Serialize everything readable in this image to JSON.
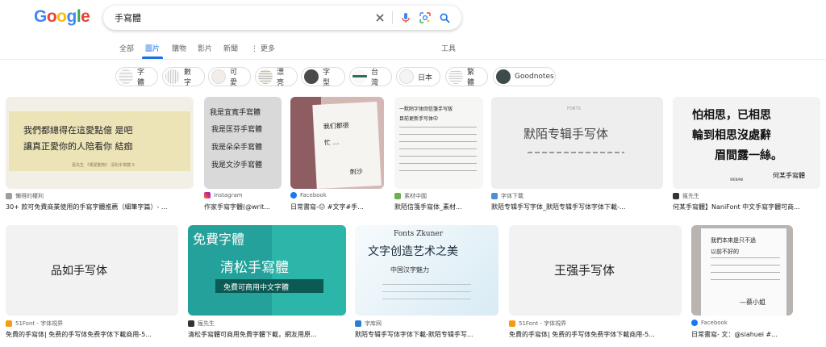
{
  "logo": {
    "text": "Google"
  },
  "search": {
    "query": "手寫體"
  },
  "nav": {
    "tabs": [
      "全部",
      "圖片",
      "購物",
      "影片",
      "新聞",
      "更多"
    ],
    "tools": "工具"
  },
  "chips": [
    "字體",
    "數字",
    "可愛",
    "漂亮",
    "字 型",
    "台灣",
    "日本",
    "繁體",
    "Goodnotes"
  ],
  "results": [
    {
      "source": "懶得的權利",
      "title": "30+ 款可免費商業使用的手寫字體推薦（細筆字篇）- ...",
      "lines": [
        "我們都總得在這愛點億 是吧",
        "讓真正愛你的人陪看你 結痂"
      ],
      "caption": "嘉先生 《嘆愛動物》 清松手寫體 5"
    },
    {
      "source": "Instagram",
      "title": "作家手寫字體(@writ...",
      "lines": [
        "我是宜寬手寫體",
        "我是匡芬手寫體",
        "我是朵朵手寫體",
        "我是文汐手寫體"
      ]
    },
    {
      "source": "Facebook",
      "title": "日常書寫-😐 #文字#手...",
      "lines": [
        "我们都很",
        "忙 …",
        "刺沙"
      ]
    },
    {
      "source": "素材中國",
      "title": "默陌信箋手寫体_素材...",
      "lines": [
        "一默陌字体回信箋手写版",
        "目前更新手写体中",
        "…"
      ]
    },
    {
      "source": "字体下載",
      "title": "默陌专辑手写字体_默陌专辑手写体字体下載-...",
      "lines": [
        "默陌专辑手写体"
      ],
      "caption": "FONTS"
    },
    {
      "source": "瘋先生",
      "title": "何某手寫體】NaniFont 中文手寫字體可商...",
      "lines": [
        "怕相思，已相思",
        "輪到相思沒處辭",
        "眉間露一絲。"
      ],
      "caption": "何某手寫體",
      "brand": "WENANI"
    },
    {
      "source": "51Font - 字体視界",
      "title": "免費的手寫体| 免费的手写体免费字体下載商用-5...",
      "lines": [
        "品如手写体"
      ]
    },
    {
      "source": "瘋先生",
      "title": "清松手寫體可商用免費字體下載，網友用原...",
      "lines": [
        "免費字體",
        "清松手寫體",
        "免費可商用中文字體"
      ]
    },
    {
      "source": "字库网",
      "title": "默陌专辑手写体字体下載-默陌专辑手写...",
      "lines": [
        "Fonts Zkuner",
        "文字创造艺术之美",
        "中国汉字魅力"
      ]
    },
    {
      "source": "51Font - 字体視界",
      "title": "免費的手寫体| 免费的手写体免费字体下載商用-5...",
      "lines": [
        "王强手写体"
      ]
    },
    {
      "source": "Facebook",
      "title": "日常書寫- 文：@siahuei #...",
      "lines": [
        "我們本來是只不過",
        "以前不好的",
        "—蔡小姐"
      ]
    }
  ]
}
